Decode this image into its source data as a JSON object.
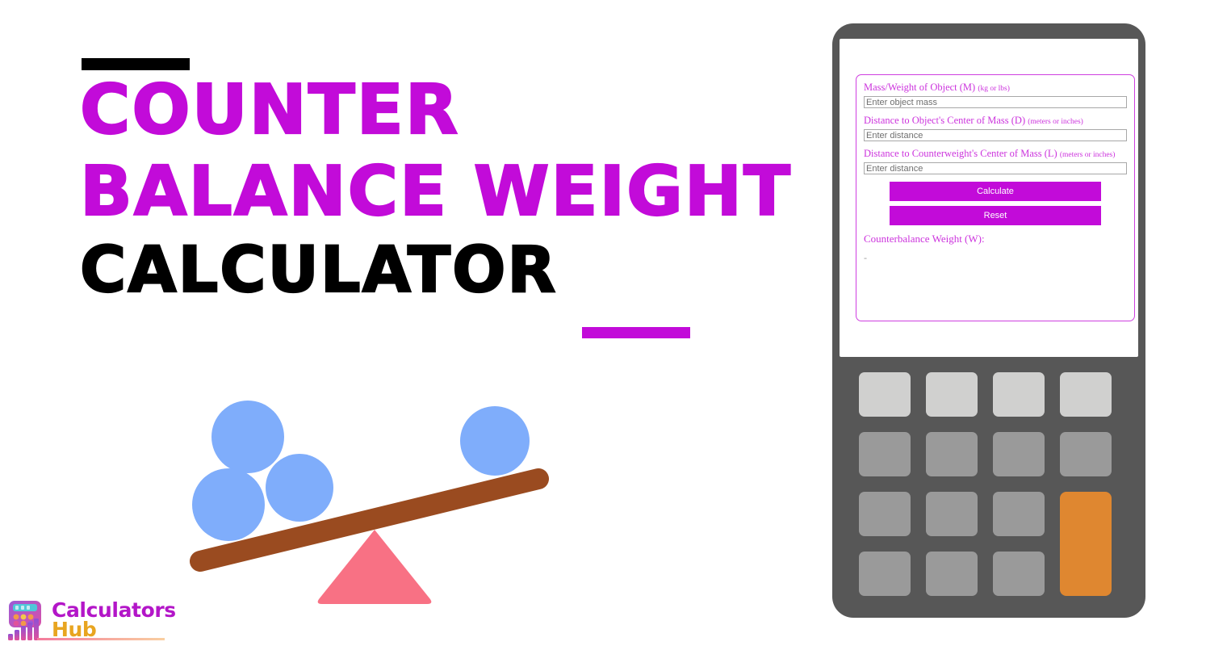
{
  "hero": {
    "title_lines": [
      "COUNTER",
      "BALANCE WEIGHT",
      "CALCULATOR"
    ],
    "accent_color_magenta": "#C20BD9",
    "accent_color_black": "#000000"
  },
  "illustration": {
    "name": "seesaw-balance-illustration",
    "plank_color": "#9A4B20",
    "ball_color": "#7FADFB",
    "fulcrum_color": "#F87184",
    "ball_count": 4
  },
  "logo": {
    "word_1": "Calculators",
    "word_2": "Hub",
    "word_1_color": "#B316C8",
    "word_2_color": "#E8A520",
    "icon_name": "calculator-bar-chart-logo-icon"
  },
  "calculator": {
    "body_color": "#575757",
    "accent_key_color": "#DF8730",
    "key_light_color": "#D0D0CF",
    "key_mid_color": "#9A9A9A",
    "keypad_rows": 4,
    "keypad_cols": 4,
    "screen": {
      "form_border_color": "#CF3FE0",
      "label_color": "#CC33DD",
      "button_color": "#C20BD9",
      "fields": [
        {
          "label_main": "Mass/Weight of Object (M)",
          "label_unit": "(kg or lbs)",
          "placeholder": "Enter object mass",
          "value": ""
        },
        {
          "label_main": "Distance to Object's Center of Mass (D)",
          "label_unit": "(meters or inches)",
          "placeholder": "Enter distance",
          "value": ""
        },
        {
          "label_main": "Distance to Counterweight's Center of Mass (L)",
          "label_unit": "(meters or inches)",
          "placeholder": "Enter distance",
          "value": ""
        }
      ],
      "calculate_label": "Calculate",
      "reset_label": "Reset",
      "result_label": "Counterbalance Weight (W):",
      "result_value": "-"
    }
  }
}
